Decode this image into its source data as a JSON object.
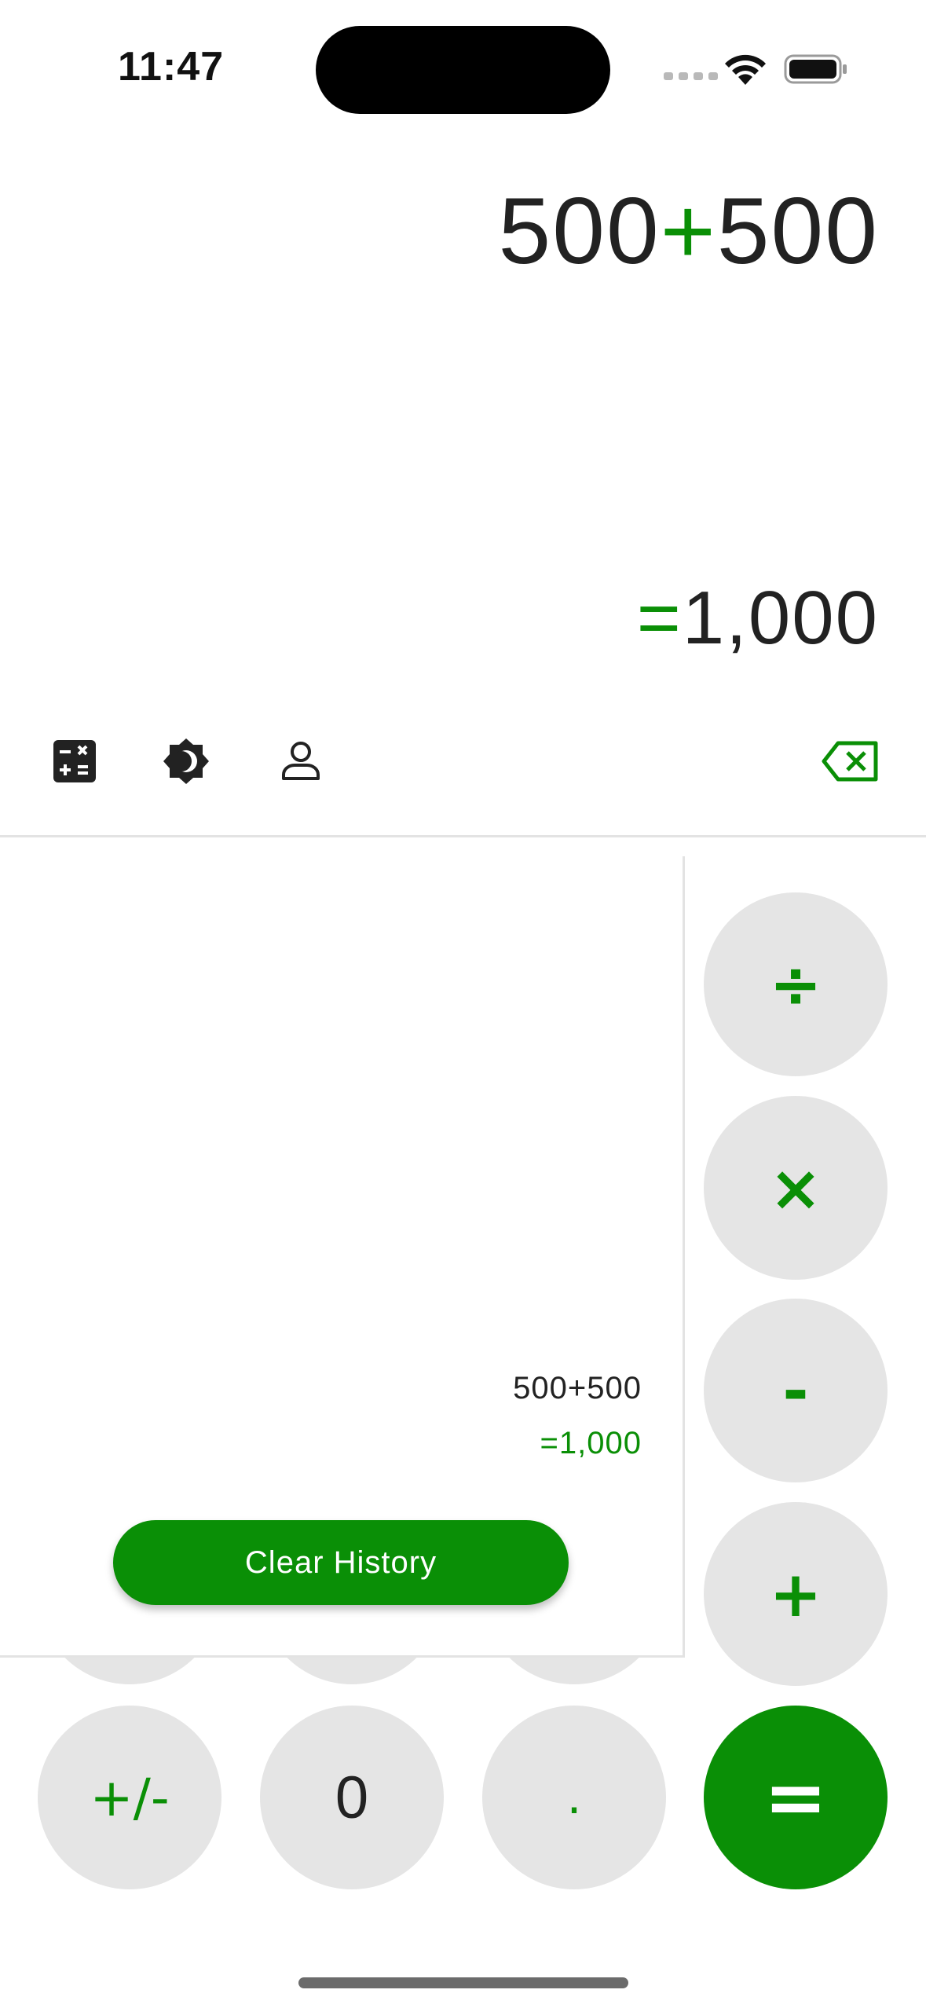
{
  "status_bar": {
    "time": "11:47"
  },
  "display": {
    "expression": {
      "left": "500",
      "operator": "+",
      "right": "500"
    },
    "result": {
      "prefix": "=",
      "value": "1,000"
    }
  },
  "toolbar": {
    "icons": [
      "calculator-icon",
      "theme-icon",
      "profile-icon",
      "backspace-icon"
    ]
  },
  "keypad": {
    "divide": "÷",
    "multiply": "×",
    "subtract": "-",
    "add": "+",
    "plus_minus": "+/-",
    "zero": "0",
    "decimal": ".",
    "equals": "="
  },
  "history": {
    "entries": [
      {
        "expression": "500+500",
        "result": "=1,000"
      }
    ],
    "clear_label": "Clear History"
  },
  "colors": {
    "accent": "#0a8f06",
    "key_bg": "#e5e5e5",
    "text": "#222222"
  }
}
